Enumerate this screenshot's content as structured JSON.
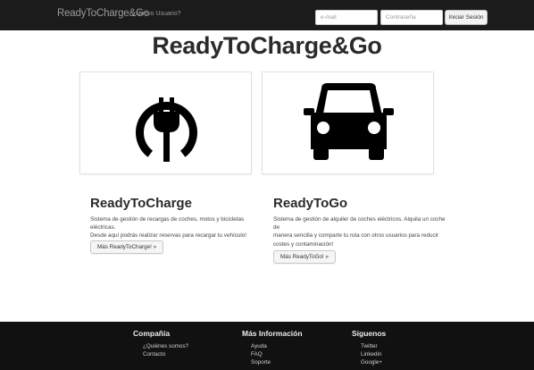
{
  "navbar": {
    "brand": "ReadyToCharge&Go",
    "new_user_link": "¿Nuevo Usuario?",
    "email_placeholder": "e-mail",
    "password_placeholder": "Contraseña",
    "login_button": "Iniciar Sesión"
  },
  "hero": {
    "title": "ReadyToCharge&Go"
  },
  "panels": {
    "charge_icon": "power-plug-icon",
    "go_icon": "car-icon"
  },
  "features": [
    {
      "title": "ReadyToCharge",
      "description_lines": [
        "Sistema de gestión de recargas de coches, motos y bicicletas eléctricas.",
        "Desde aquí podrás realizar reservas para recargar tu vehículo!"
      ],
      "button": "Más ReadyToCharge! »"
    },
    {
      "title": "ReadyToGo",
      "description_lines": [
        "Sistema de gestión de alquiler de coches eléctricos. Alquila un coche de",
        "manera sencilla y comparte tu ruta con otros usuarios para reducir",
        "costes y contaminación!"
      ],
      "button": "Más ReadyToGo! »"
    }
  ],
  "footer": {
    "columns": [
      {
        "heading": "Compañía",
        "links": [
          "¿Quiénes somos?",
          "Contacto"
        ]
      },
      {
        "heading": "Más Información",
        "links": [
          "Ayuda",
          "FAQ",
          "Soporte"
        ]
      },
      {
        "heading": "Síguenos",
        "links": [
          "Twitter",
          "Linkedin",
          "Google+"
        ]
      }
    ]
  },
  "colors": {
    "navbar_bg": "#1b1b1b",
    "footer_bg": "#111111",
    "icon_fill": "#000000"
  }
}
